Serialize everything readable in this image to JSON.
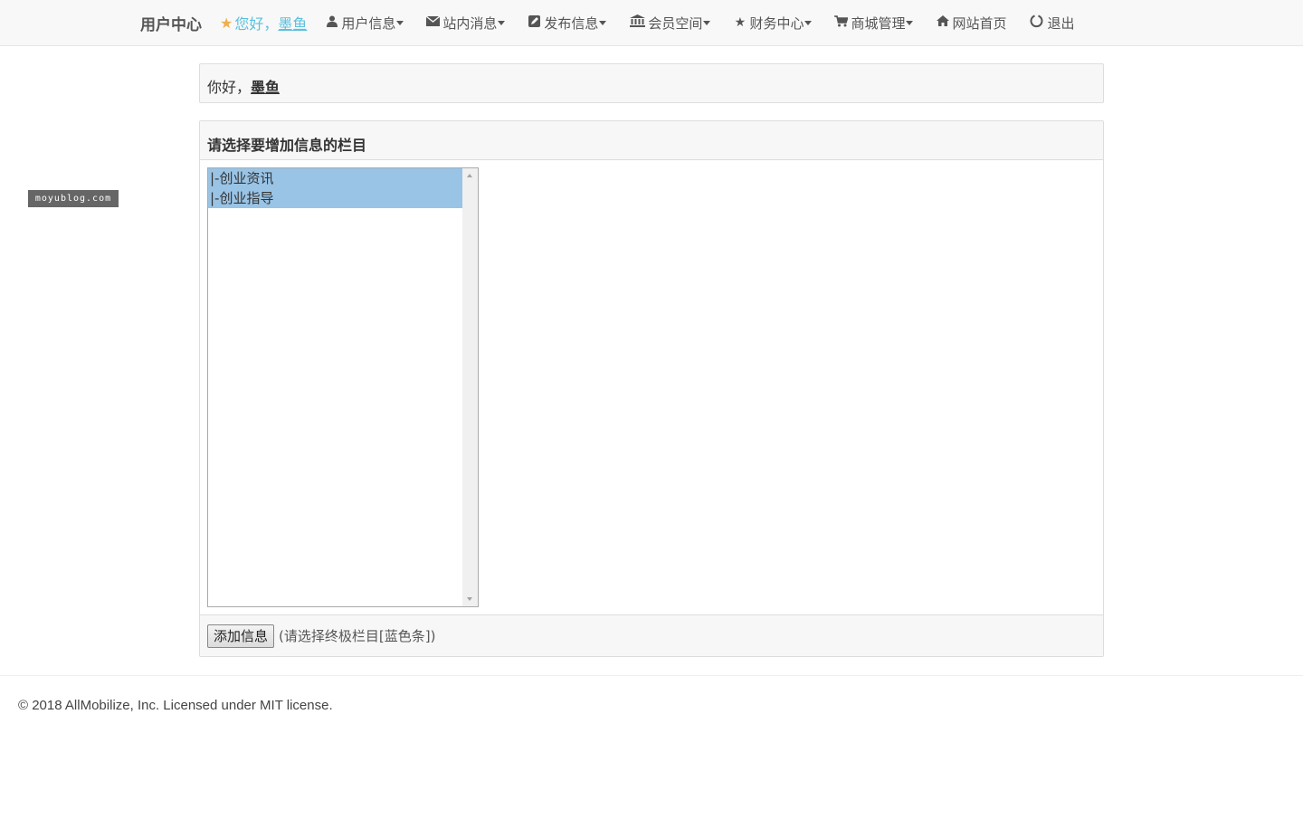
{
  "navbar": {
    "brand": "用户中心",
    "greeting_prefix": "您好，",
    "username": "墨鱼",
    "items": [
      {
        "label": "用户信息",
        "icon": "user-icon",
        "dropdown": true
      },
      {
        "label": "站内消息",
        "icon": "envelope-icon",
        "dropdown": true
      },
      {
        "label": "发布信息",
        "icon": "edit-icon",
        "dropdown": true
      },
      {
        "label": "会员空间",
        "icon": "bank-icon",
        "dropdown": true
      },
      {
        "label": "财务中心",
        "icon": "star-icon",
        "dropdown": true
      },
      {
        "label": "商城管理",
        "icon": "cart-icon",
        "dropdown": true
      },
      {
        "label": "网站首页",
        "icon": "home-icon",
        "dropdown": false
      },
      {
        "label": "退出",
        "icon": "power-icon",
        "dropdown": false
      }
    ]
  },
  "watermark": "moyublog.com",
  "hello_panel": {
    "prefix": "你好，",
    "username": "墨鱼"
  },
  "main_panel": {
    "heading": "请选择要增加信息的栏目",
    "options": [
      "|-创业资讯",
      "|-创业指导"
    ],
    "add_button": "添加信息",
    "hint": "(请选择终极栏目[蓝色条])"
  },
  "footer": {
    "copyright": "© 2018 AllMobilize, Inc. Licensed under MIT license."
  },
  "colors": {
    "accent": "#5bc0de",
    "selected_option": "#99c4e6",
    "star": "#f0ad4e"
  }
}
